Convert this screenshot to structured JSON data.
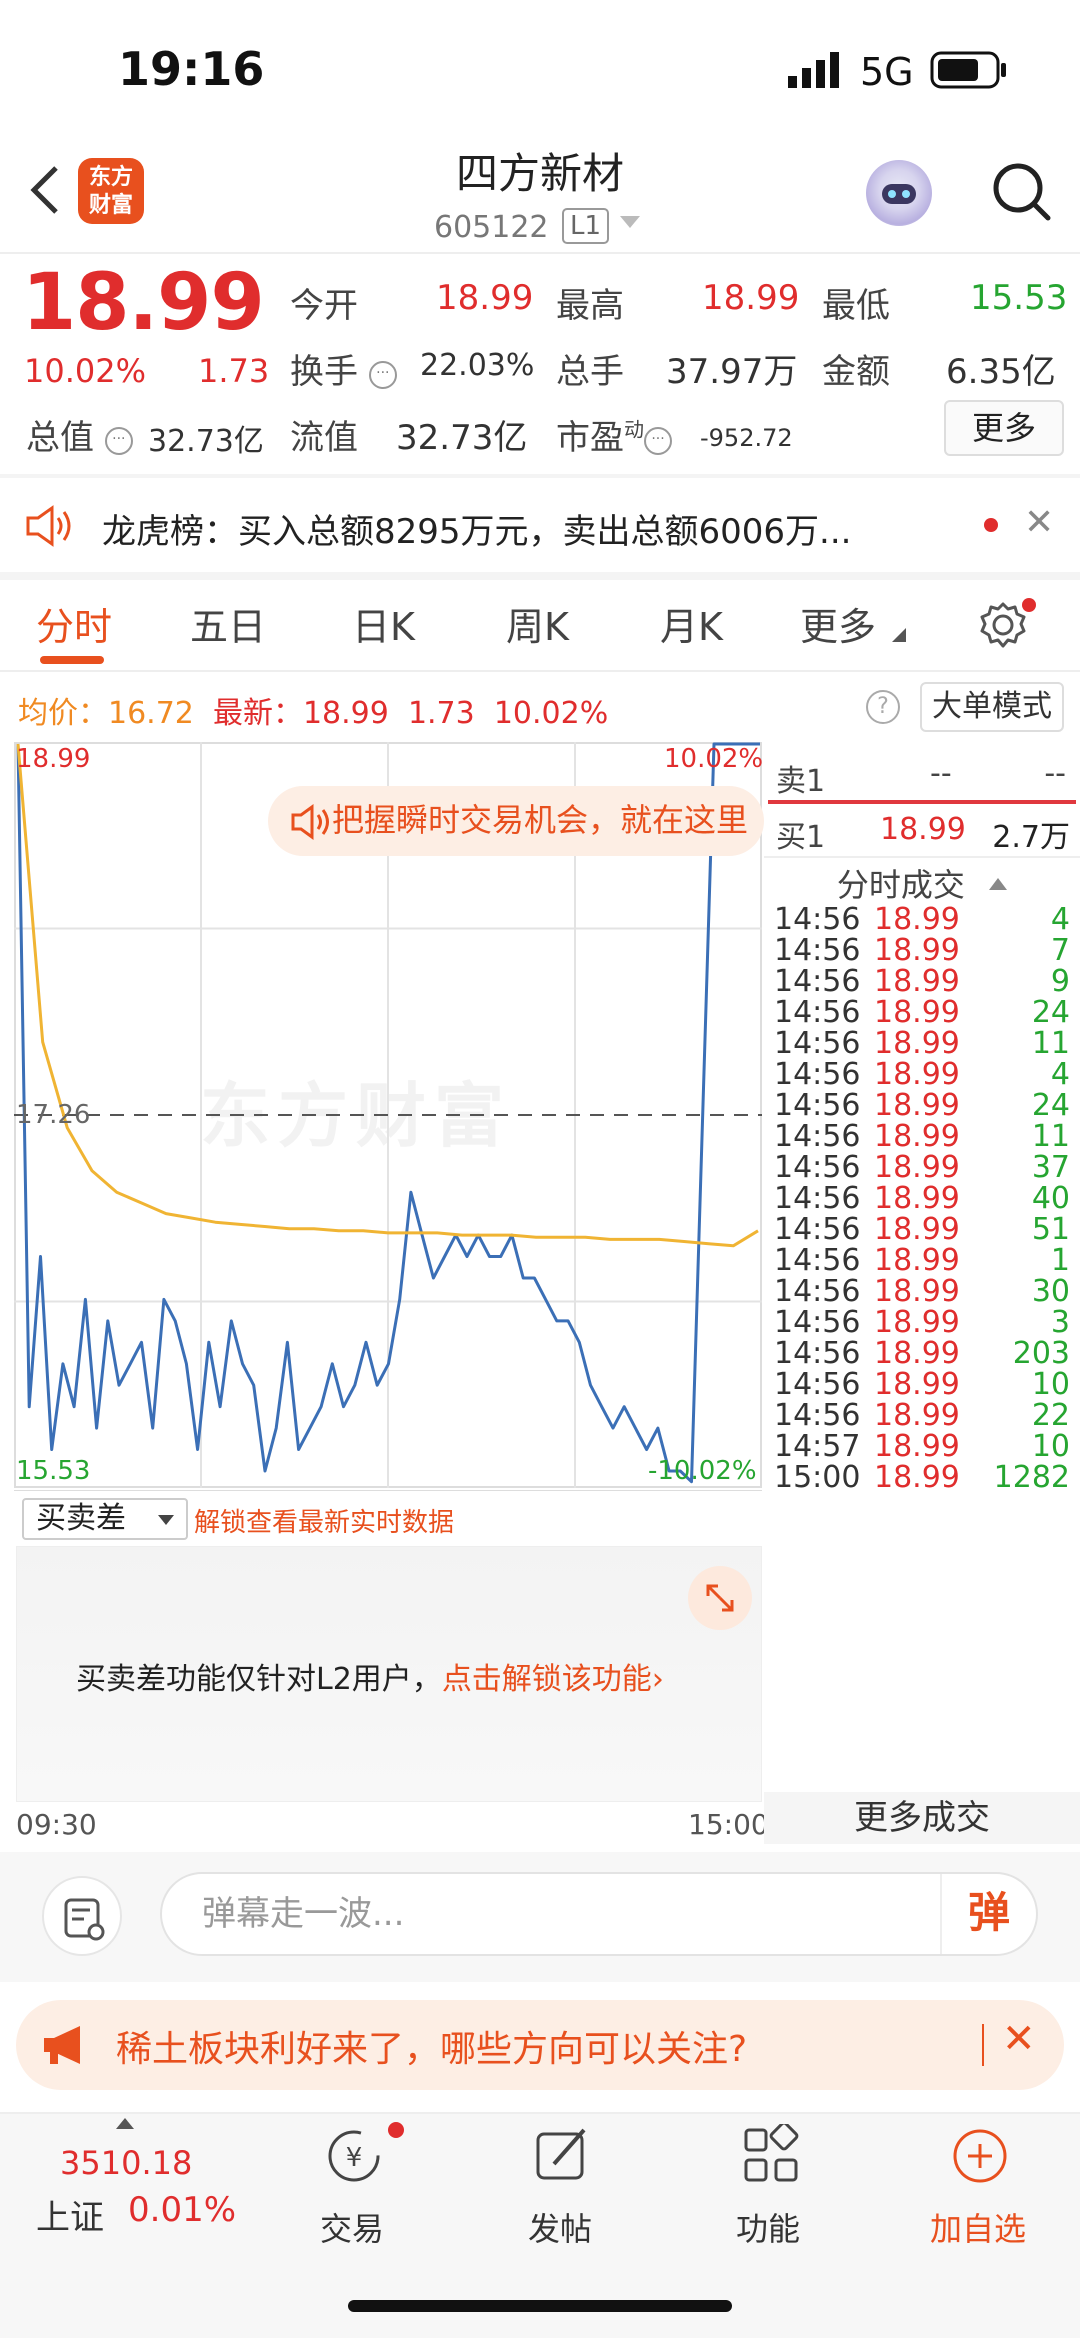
{
  "status_bar": {
    "time": "19:16",
    "network": "5G"
  },
  "header": {
    "logo_text_line1": "东方",
    "logo_text_line2": "财富",
    "stock_name": "四方新材",
    "stock_code": "605122",
    "level": "L1"
  },
  "quote": {
    "price": "18.99",
    "pct_change": "10.02%",
    "change": "1.73",
    "open_label": "今开",
    "open_value": "18.99",
    "high_label": "最高",
    "high_value": "18.99",
    "low_label": "最低",
    "low_value": "15.53",
    "turnover_label": "换手",
    "turnover_value": "22.03%",
    "volume_label": "总手",
    "volume_value": "37.97万",
    "amount_label": "金额",
    "amount_value": "6.35亿",
    "mktcap_label": "总值",
    "mktcap_value": "32.73亿",
    "float_label": "流值",
    "float_value": "32.73亿",
    "pe_label": "市盈",
    "pe_sup": "动",
    "pe_value": "-952.72",
    "more_label": "更多"
  },
  "lhb": {
    "text": "龙虎榜：买入总额8295万元，卖出总额6006万..."
  },
  "tabs": [
    {
      "label": "分时"
    },
    {
      "label": "五日"
    },
    {
      "label": "日K"
    },
    {
      "label": "周K"
    },
    {
      "label": "月K"
    },
    {
      "label": "更多"
    }
  ],
  "info_line": {
    "avg_label": "均价：",
    "avg_value": "16.72",
    "last_label": "最新：",
    "last_value": "18.99",
    "change": "1.73",
    "pct": "10.02%",
    "help": "?",
    "bigorder_label": "大单模式"
  },
  "chart_labels": {
    "top_price": "18.99",
    "top_pct": "10.02%",
    "mid_price": "17.26",
    "bottom_price": "15.53",
    "bottom_pct": "-10.02%",
    "time_start": "09:30",
    "time_end": "15:00",
    "watermark": "东方财富"
  },
  "promo": {
    "text": "把握瞬时交易机会，就在这里"
  },
  "order_book": {
    "sell1_label": "卖1",
    "sell1_price": "--",
    "sell1_vol": "--",
    "buy1_label": "买1",
    "buy1_price": "18.99",
    "buy1_vol": "2.7万",
    "trades_title": "分时成交"
  },
  "trades": [
    {
      "time": "14:56",
      "price": "18.99",
      "vol": "4"
    },
    {
      "time": "14:56",
      "price": "18.99",
      "vol": "7"
    },
    {
      "time": "14:56",
      "price": "18.99",
      "vol": "9"
    },
    {
      "time": "14:56",
      "price": "18.99",
      "vol": "24"
    },
    {
      "time": "14:56",
      "price": "18.99",
      "vol": "11"
    },
    {
      "time": "14:56",
      "price": "18.99",
      "vol": "4"
    },
    {
      "time": "14:56",
      "price": "18.99",
      "vol": "24"
    },
    {
      "time": "14:56",
      "price": "18.99",
      "vol": "11"
    },
    {
      "time": "14:56",
      "price": "18.99",
      "vol": "37"
    },
    {
      "time": "14:56",
      "price": "18.99",
      "vol": "40"
    },
    {
      "time": "14:56",
      "price": "18.99",
      "vol": "51"
    },
    {
      "time": "14:56",
      "price": "18.99",
      "vol": "1"
    },
    {
      "time": "14:56",
      "price": "18.99",
      "vol": "30"
    },
    {
      "time": "14:56",
      "price": "18.99",
      "vol": "3"
    },
    {
      "time": "14:56",
      "price": "18.99",
      "vol": "203"
    },
    {
      "time": "14:56",
      "price": "18.99",
      "vol": "10"
    },
    {
      "time": "14:56",
      "price": "18.99",
      "vol": "22"
    },
    {
      "time": "14:57",
      "price": "18.99",
      "vol": "10"
    },
    {
      "time": "15:00",
      "price": "18.99",
      "vol": "1282"
    }
  ],
  "more_trades_label": "更多成交",
  "diff": {
    "select_label": "买卖差",
    "unlock_link": "解锁查看最新实时数据",
    "msg_prefix": "买卖差功能仅针对L2用户，",
    "msg_link": "点击解锁该功能"
  },
  "danmu": {
    "placeholder": "弹幕走一波...",
    "send_label": "弹"
  },
  "notice": {
    "text": "稀土板块利好来了，哪些方向可以关注?"
  },
  "bottom_nav": {
    "index_value": "3510.18",
    "index_name": "上证",
    "index_pct": "0.01%",
    "items": [
      {
        "label": "交易"
      },
      {
        "label": "发帖"
      },
      {
        "label": "功能"
      },
      {
        "label": "加自选"
      }
    ]
  },
  "colors": {
    "up": "#e02d2d",
    "down": "#26a531",
    "brand": "#e8501e",
    "price_line": "#3b6fb6",
    "avg_line": "#f0b433"
  },
  "chart_data": {
    "type": "line",
    "x": [
      "09:30",
      "15:00"
    ],
    "ylim": [
      15.53,
      18.99
    ],
    "reference_price": 17.26,
    "series": [
      {
        "name": "最新",
        "values": [
          18.99,
          15.9,
          16.6,
          15.7,
          16.1,
          15.9,
          16.4,
          15.8,
          16.3,
          16.0,
          16.1,
          16.2,
          15.8,
          16.4,
          16.3,
          16.1,
          15.7,
          16.2,
          15.9,
          16.3,
          16.1,
          16.0,
          15.6,
          15.8,
          16.2,
          15.7,
          15.8,
          15.9,
          16.1,
          15.9,
          16.0,
          16.2,
          16.0,
          16.1,
          16.4,
          16.9,
          16.7,
          16.5,
          16.6,
          16.7,
          16.6,
          16.7,
          16.6,
          16.6,
          16.7,
          16.5,
          16.5,
          16.4,
          16.3,
          16.3,
          16.2,
          16.0,
          15.9,
          15.8,
          15.9,
          15.8,
          15.7,
          15.8,
          15.6,
          15.6,
          15.55,
          18.99,
          18.99
        ]
      },
      {
        "name": "均价",
        "values": [
          18.99,
          17.6,
          17.2,
          17.0,
          16.9,
          16.85,
          16.8,
          16.78,
          16.76,
          16.75,
          16.74,
          16.73,
          16.73,
          16.72,
          16.72,
          16.71,
          16.71,
          16.71,
          16.7,
          16.7,
          16.7,
          16.69,
          16.69,
          16.69,
          16.68,
          16.68,
          16.68,
          16.67,
          16.66,
          16.65,
          16.72
        ]
      }
    ]
  }
}
